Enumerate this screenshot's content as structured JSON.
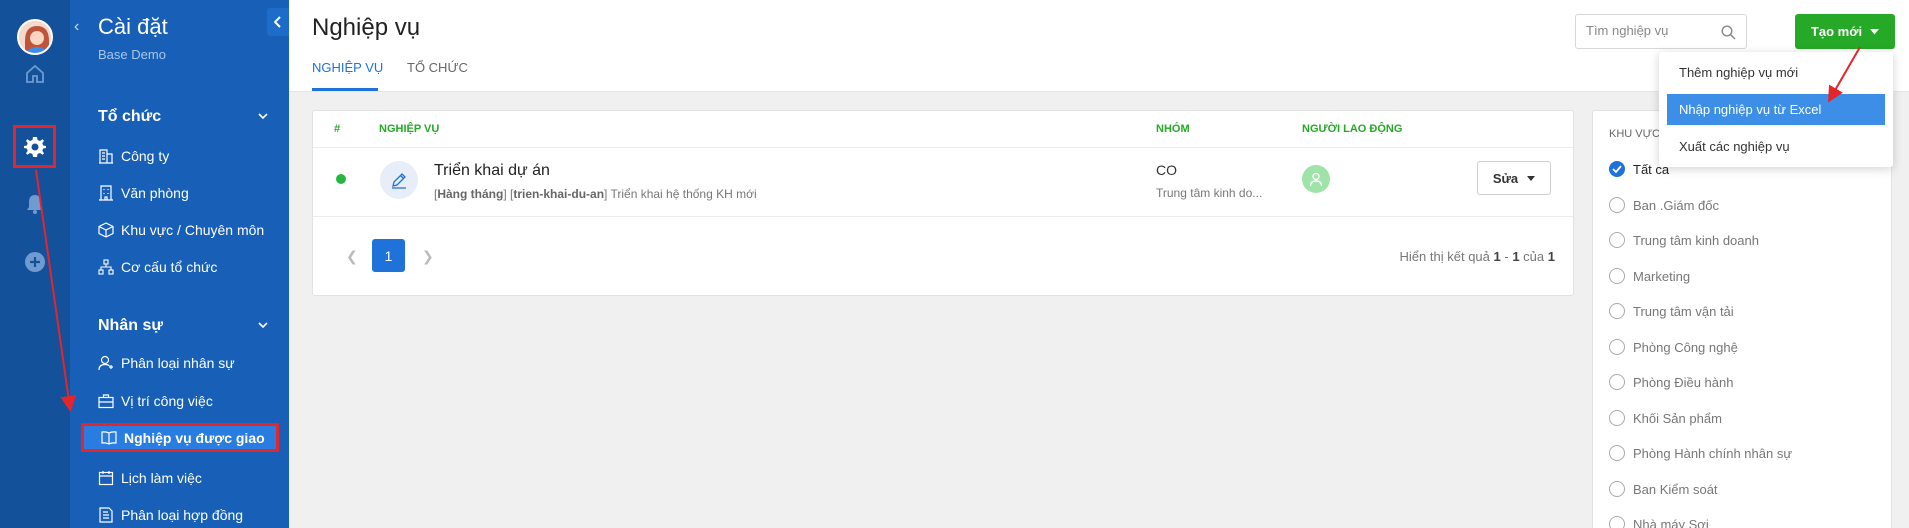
{
  "sidebar": {
    "title": "Cài đặt",
    "subtitle": "Base Demo",
    "sections": [
      {
        "title": "Tổ chức",
        "items": [
          "Công ty",
          "Văn phòng",
          "Khu vực / Chuyên môn",
          "Cơ cấu tổ chức"
        ]
      },
      {
        "title": "Nhân sự",
        "items": [
          "Phân loại nhân sự",
          "Vị trí công việc",
          "Nghiệp vụ được giao",
          "Lịch làm việc",
          "Phân loại hợp đồng"
        ]
      }
    ],
    "active_item": "Nghiệp vụ được giao"
  },
  "header": {
    "title": "Nghiệp vụ",
    "tabs": [
      "NGHIỆP VỤ",
      "TỔ CHỨC"
    ],
    "search_placeholder": "Tìm nghiệp vụ",
    "create_label": "Tạo mới"
  },
  "dropdown": {
    "items": [
      "Thêm nghiệp vụ mới",
      "Nhập nghiệp vụ từ Excel",
      "Xuất các nghiệp vụ"
    ],
    "selected_index": 1
  },
  "table": {
    "columns": [
      "#",
      "NGHIỆP VỤ",
      "NHÓM",
      "NGƯỜI LAO ĐỘNG"
    ],
    "row": {
      "name": "Triển khai dự án",
      "tag1": "Hàng tháng",
      "tag2": "trien-khai-du-an",
      "desc": "Triển khai hệ thống KH mới",
      "group": "CO",
      "group_sub": "Trung tâm kinh do...",
      "edit_label": "Sửa"
    },
    "pagination": {
      "current": "1",
      "info_prefix": "Hiển thị kết quả",
      "from": "1",
      "to": "1",
      "of_label": "của",
      "total": "1"
    }
  },
  "filter": {
    "header": "KHU VỰC",
    "options": [
      "Tất cả",
      "Ban .Giám đốc",
      "Trung tâm kinh doanh",
      "Marketing",
      "Trung tâm vận tải",
      "Phòng Công nghệ",
      "Phòng Điều hành",
      "Khối Sản phẩm",
      "Phòng Hành chính nhân sự",
      "Ban Kiểm soát",
      "Nhà máy Sợi"
    ],
    "selected_index": 0
  },
  "colors": {
    "rail": "#13519b",
    "sidebar": "#175fb7",
    "accent": "#1e72d9",
    "create_button": "#25a927",
    "highlight": "#e4252b"
  }
}
